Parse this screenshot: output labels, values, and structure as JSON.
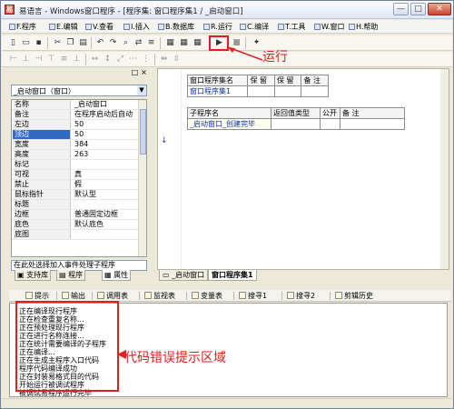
{
  "window": {
    "app_icon_glyph": "易",
    "title": "易语言 - Windows窗口程序 - [程序集: 窗口程序集1 / _启动窗口]",
    "min_label": "—",
    "max_label": "□",
    "close_label": "✕"
  },
  "menu": [
    {
      "label": "F.程序"
    },
    {
      "label": "E.编辑"
    },
    {
      "label": "V.查看"
    },
    {
      "label": "I.插入"
    },
    {
      "label": "B.数据库"
    },
    {
      "label": "R.运行"
    },
    {
      "label": "C.编译"
    },
    {
      "label": "T.工具"
    },
    {
      "label": "W.窗口"
    },
    {
      "label": "H.帮助"
    }
  ],
  "annotation": {
    "run_label": "运行",
    "error_area_label": "代码错误提示区域",
    "arrow_color": "#e02020"
  },
  "left_panel": {
    "combo_value": "_启动窗口（窗口）",
    "pin_label": "□",
    "close_label": "×",
    "properties": [
      {
        "name": "名称",
        "value": "_启动窗口"
      },
      {
        "name": "备注",
        "value": "在程序启动后自动"
      },
      {
        "name": "左边",
        "value": "50"
      },
      {
        "name": "顶边",
        "value": "50"
      },
      {
        "name": "宽度",
        "value": "384"
      },
      {
        "name": "高度",
        "value": "263"
      },
      {
        "name": "标记",
        "value": ""
      },
      {
        "name": "可视",
        "value": "真"
      },
      {
        "name": "禁止",
        "value": "假"
      },
      {
        "name": "鼠标指针",
        "value": "默认型"
      },
      {
        "name": "标题",
        "value": ""
      },
      {
        "name": "边框",
        "value": "普通固定边框"
      },
      {
        "name": "底色",
        "value": "默认底色"
      },
      {
        "name": "底图",
        "value": ""
      }
    ],
    "event_combo": "在此处选择加入事件处理子程序",
    "tabs": [
      {
        "label": "支持库"
      },
      {
        "label": "程序"
      },
      {
        "label": "属性"
      }
    ]
  },
  "document": {
    "assembly_headers": [
      "窗口程序集名",
      "保 留",
      "保 留",
      "备 注"
    ],
    "assembly_row": [
      "窗口程序集1",
      "",
      "",
      ""
    ],
    "sub_headers": [
      "子程序名",
      "返回值类型",
      "公开",
      "备 注"
    ],
    "sub_row": [
      "_启动窗口_创建完毕",
      "",
      "",
      ""
    ],
    "caret_glyph": "↓",
    "tabs": [
      {
        "label": "_启动窗口"
      },
      {
        "label": "窗口程序集1"
      }
    ]
  },
  "bottom_tabs": [
    {
      "label": "提示"
    },
    {
      "label": "输出"
    },
    {
      "label": "调用表"
    },
    {
      "label": "监视表"
    },
    {
      "label": "变量表"
    },
    {
      "label": "搜寻1"
    },
    {
      "label": "搜寻2"
    },
    {
      "label": "剪辑历史"
    }
  ],
  "output_lines": [
    "正在编译现行程序",
    "正在检查重复名称...",
    "正在预处理现行程序",
    "正在进行名称连接...",
    "正在统计需要编译的子程序",
    "正在编译...",
    "正在生成主程序入口代码",
    "程序代码编译成功",
    "正在封装易格式目的代码",
    "开始运行被调试程序",
    "被调试易程序运行完毕"
  ]
}
